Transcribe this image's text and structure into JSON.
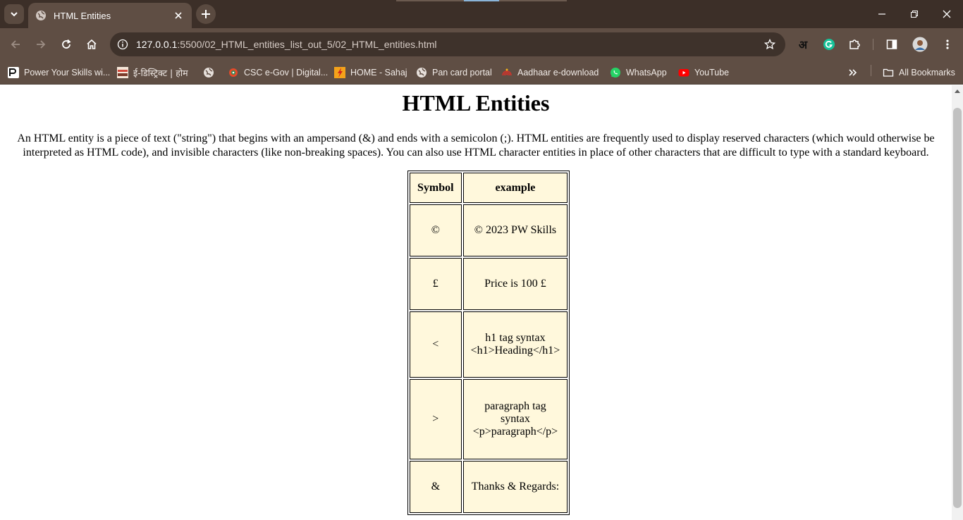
{
  "browser": {
    "tab_title": "HTML Entities",
    "url_host": "127.0.0.1",
    "url_rest": ":5500/02_HTML_entities_list_out_5/02_HTML_entities.html",
    "extension_hindi_letter": "अ",
    "bookmarks": [
      {
        "label": "Power Your Skills wi...",
        "icon": "pw-logo-icon"
      },
      {
        "label": "ई-डिस्ट्रिक्ट | होम",
        "icon": "edistrict-icon"
      },
      {
        "label": "",
        "icon": "globe-icon"
      },
      {
        "label": "CSC e-Gov | Digital...",
        "icon": "csc-icon"
      },
      {
        "label": "HOME - Sahaj",
        "icon": "sahaj-icon"
      },
      {
        "label": "Pan card portal",
        "icon": "globe-icon"
      },
      {
        "label": "Aadhaar e-download",
        "icon": "aadhaar-icon"
      },
      {
        "label": "WhatsApp",
        "icon": "whatsapp-icon"
      },
      {
        "label": "YouTube",
        "icon": "youtube-icon"
      }
    ],
    "all_bookmarks_label": "All Bookmarks"
  },
  "page": {
    "title": "HTML Entities",
    "intro": "An HTML entity is a piece of text (\"string\") that begins with an ampersand (&) and ends with a semicolon (;). HTML entities are frequently used to display reserved characters (which would otherwise be interpreted as HTML code), and invisible characters (like non-breaking spaces). You can also use HTML character entities in place of other characters that are difficult to type with a standard keyboard.",
    "table": {
      "headers": [
        "Symbol",
        "example"
      ],
      "rows": [
        {
          "symbol": "©",
          "example": "© 2023 PW Skills"
        },
        {
          "symbol": "£",
          "example": "Price is 100 £"
        },
        {
          "symbol": "<",
          "example": "h1 tag syntax <h1>Heading</h1>"
        },
        {
          "symbol": ">",
          "example": "paragraph tag syntax <p>paragraph</p>"
        },
        {
          "symbol": "&",
          "example": "Thanks & Regards:"
        }
      ]
    }
  },
  "colors": {
    "chrome_dark": "#3c2f28",
    "chrome": "#5f4e44",
    "table_cell_bg": "#fff8dc"
  }
}
